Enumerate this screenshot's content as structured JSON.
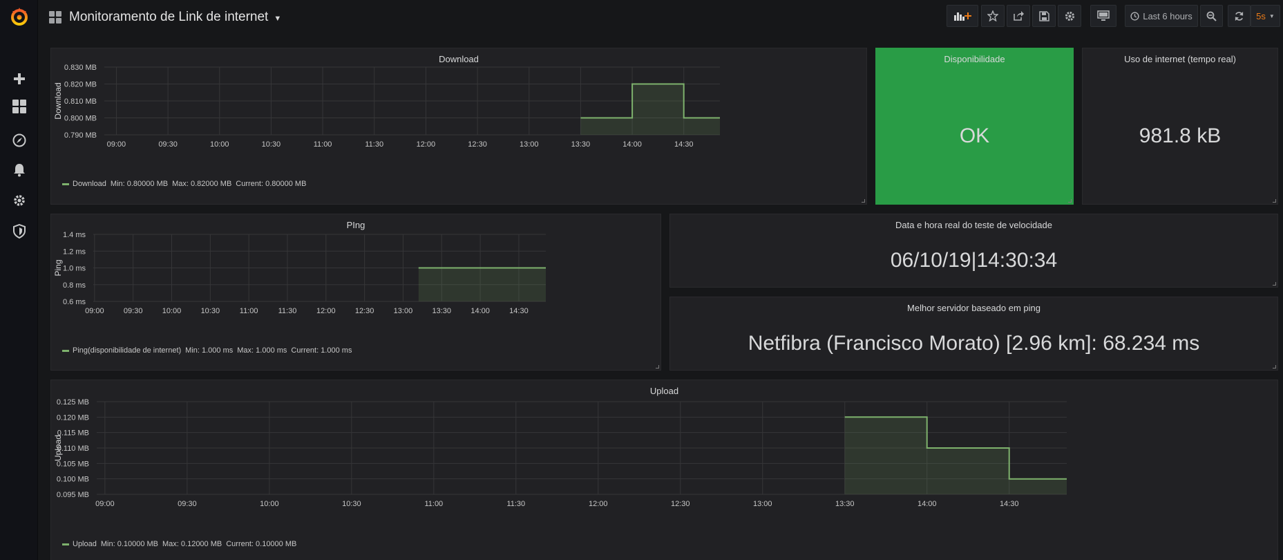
{
  "nav": {
    "title": "Monitoramento de Link de internet",
    "time_range": "Last 6 hours",
    "refresh": "5s"
  },
  "panels": {
    "download": {
      "title": "Download",
      "legend": {
        "name": "Download",
        "min": "Min: 0.80000 MB",
        "max": "Max: 0.82000 MB",
        "current": "Current: 0.80000 MB"
      }
    },
    "availability": {
      "title": "Disponibilidade",
      "value": "OK"
    },
    "usage": {
      "title": "Uso de internet (tempo real)",
      "value": "981.8 kB"
    },
    "ping": {
      "title": "PIng",
      "legend": {
        "name": "Ping(disponibilidade de internet)",
        "min": "Min: 1.000 ms",
        "max": "Max: 1.000 ms",
        "current": "Current: 1.000 ms"
      }
    },
    "datetime": {
      "title": "Data e hora real do teste de velocidade",
      "value": "06/10/19|14:30:34"
    },
    "best_server": {
      "title": "Melhor servidor baseado em ping",
      "value": "Netfibra (Francisco Morato) [2.96 km]: 68.234 ms"
    },
    "upload": {
      "title": "Upload",
      "legend": {
        "name": "Upload",
        "min": "Min: 0.10000 MB",
        "max": "Max: 0.12000 MB",
        "current": "Current: 0.10000 MB"
      }
    }
  },
  "colors": {
    "series": "#7eb26d",
    "ok_bg": "#299c46",
    "accent": "#eb7b18"
  },
  "chart_data": [
    {
      "type": "area",
      "title": "Download",
      "ylabel": "Download",
      "x_ticks": [
        "09:00",
        "09:30",
        "10:00",
        "10:30",
        "11:00",
        "11:30",
        "12:00",
        "12:30",
        "13:00",
        "13:30",
        "14:00",
        "14:30"
      ],
      "y_ticks": [
        "0.790 MB",
        "0.800 MB",
        "0.810 MB",
        "0.820 MB",
        "0.830 MB"
      ],
      "ylim": [
        0.79,
        0.83
      ],
      "xlim": [
        "08:53",
        "14:51"
      ],
      "series": [
        {
          "name": "Download",
          "step": true,
          "x": [
            "13:30",
            "14:00",
            "14:30",
            "14:51"
          ],
          "y": [
            0.8,
            0.82,
            0.8,
            0.8
          ]
        }
      ]
    },
    {
      "type": "area",
      "title": "PIng",
      "ylabel": "Ping",
      "x_ticks": [
        "09:00",
        "09:30",
        "10:00",
        "10:30",
        "11:00",
        "11:30",
        "12:00",
        "12:30",
        "13:00",
        "13:30",
        "14:00",
        "14:30"
      ],
      "y_ticks": [
        "0.6 ms",
        "0.8 ms",
        "1.0 ms",
        "1.2 ms",
        "1.4 ms"
      ],
      "ylim": [
        0.6,
        1.4
      ],
      "xlim": [
        "08:59",
        "14:51"
      ],
      "series": [
        {
          "name": "Ping(disponibilidade de internet)",
          "step": true,
          "x": [
            "13:12",
            "14:51"
          ],
          "y": [
            1.0,
            1.0
          ]
        }
      ]
    },
    {
      "type": "area",
      "title": "Upload",
      "ylabel": "Upload",
      "x_ticks": [
        "09:00",
        "09:30",
        "10:00",
        "10:30",
        "11:00",
        "11:30",
        "12:00",
        "12:30",
        "13:00",
        "13:30",
        "14:00",
        "14:30"
      ],
      "y_ticks": [
        "0.095 MB",
        "0.100 MB",
        "0.105 MB",
        "0.110 MB",
        "0.115 MB",
        "0.120 MB",
        "0.125 MB"
      ],
      "ylim": [
        0.095,
        0.125
      ],
      "xlim": [
        "08:57",
        "14:51"
      ],
      "series": [
        {
          "name": "Upload",
          "step": true,
          "x": [
            "13:30",
            "14:00",
            "14:30",
            "14:51"
          ],
          "y": [
            0.12,
            0.11,
            0.1,
            0.1
          ]
        }
      ]
    }
  ]
}
